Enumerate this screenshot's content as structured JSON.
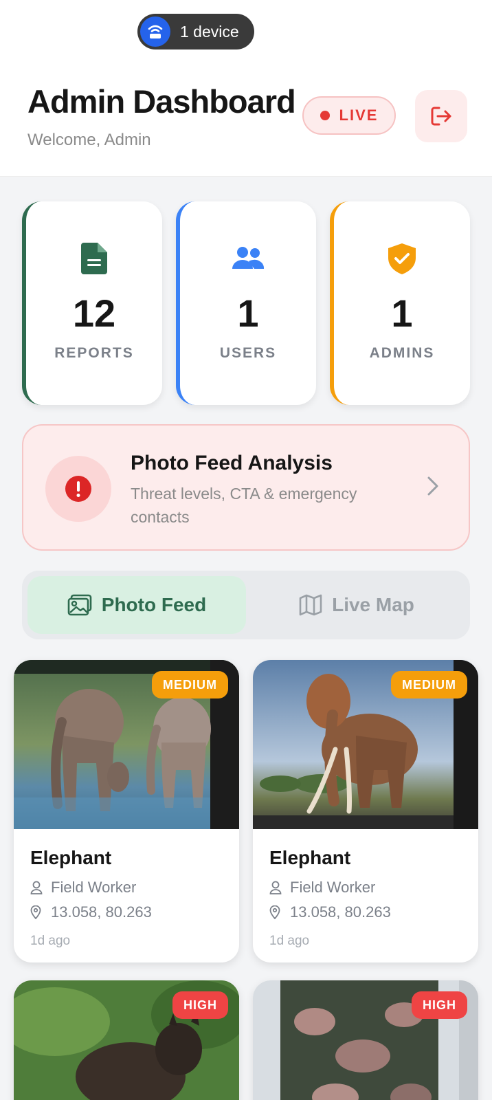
{
  "header": {
    "device_count_label": "1 device",
    "title": "Admin Dashboard",
    "subtitle": "Welcome, Admin",
    "live_label": "LIVE"
  },
  "stats": [
    {
      "value": "12",
      "label": "REPORTS",
      "icon": "document-icon",
      "accent": "#2e6b4f"
    },
    {
      "value": "1",
      "label": "USERS",
      "icon": "users-icon",
      "accent": "#3b82f6"
    },
    {
      "value": "1",
      "label": "ADMINS",
      "icon": "shield-check-icon",
      "accent": "#f59e0b"
    }
  ],
  "analysis": {
    "title": "Photo Feed Analysis",
    "subtitle": "Threat levels, CTA & emergency contacts"
  },
  "tabs": [
    {
      "label": "Photo Feed",
      "active": true
    },
    {
      "label": "Live Map",
      "active": false
    }
  ],
  "feed": [
    {
      "animal": "Elephant",
      "severity": "MEDIUM",
      "reporter": "Field Worker",
      "coords": "13.058, 80.263",
      "time": "1d ago"
    },
    {
      "animal": "Elephant",
      "severity": "MEDIUM",
      "reporter": "Field Worker",
      "coords": "13.058, 80.263",
      "time": "1d ago"
    },
    {
      "animal": "",
      "severity": "HIGH",
      "reporter": "",
      "coords": "",
      "time": ""
    },
    {
      "animal": "",
      "severity": "HIGH",
      "reporter": "",
      "coords": "",
      "time": ""
    }
  ],
  "colors": {
    "primary_green": "#2e6b4f",
    "live_red": "#e53935",
    "medium": "#f59e0b",
    "high": "#ef4444",
    "users_blue": "#3b82f6"
  }
}
